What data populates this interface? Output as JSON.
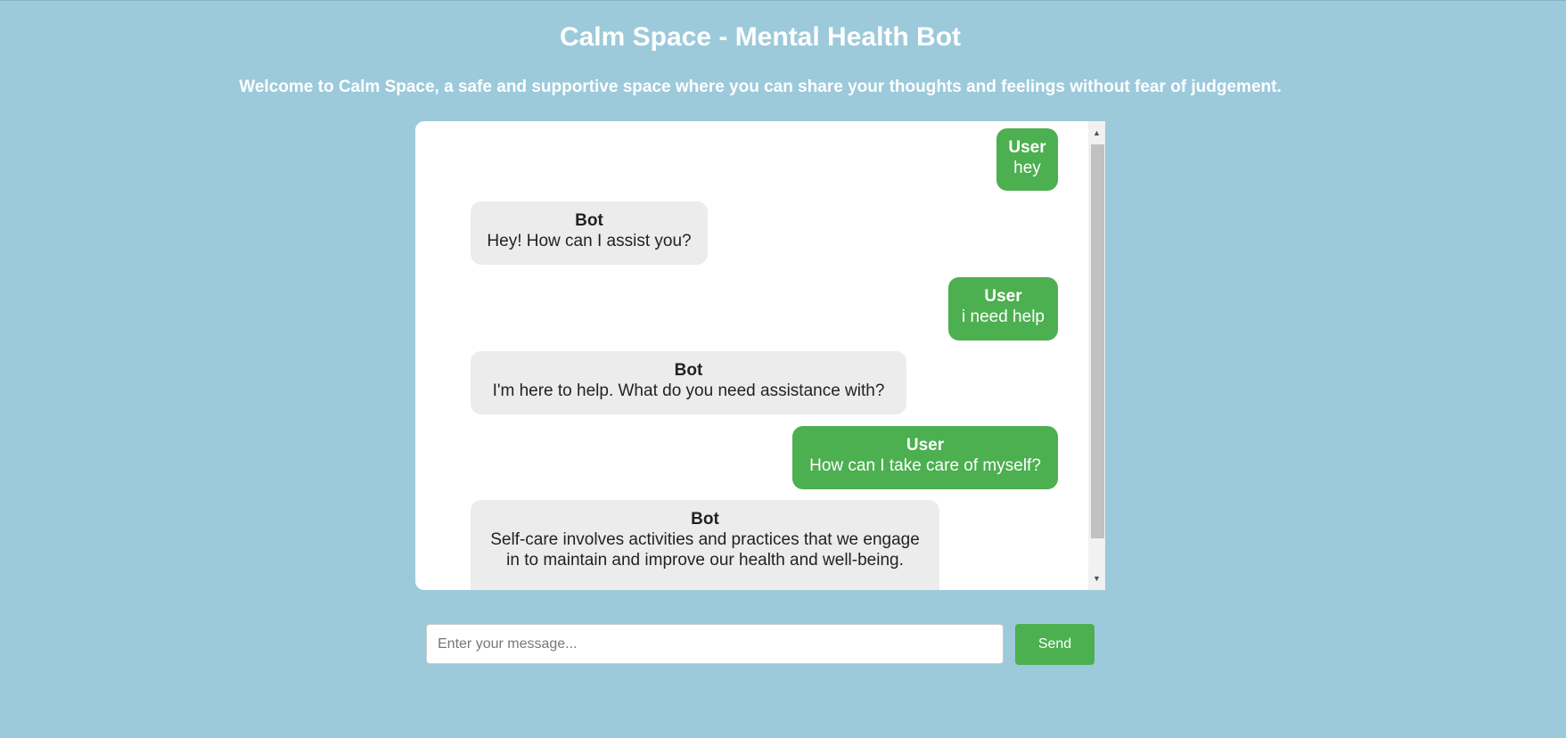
{
  "header": {
    "title": "Calm Space - Mental Health Bot",
    "subtitle": "Welcome to Calm Space, a safe and supportive space where you can share your thoughts and feelings without fear of judgement."
  },
  "chat": {
    "messages": [
      {
        "role": "user",
        "sender": "User",
        "text": "hey"
      },
      {
        "role": "bot",
        "sender": "Bot",
        "text": "Hey! How can I assist you?"
      },
      {
        "role": "user",
        "sender": "User",
        "text": "i need help"
      },
      {
        "role": "bot",
        "sender": "Bot",
        "text": "I'm here to help. What do you need assistance with?"
      },
      {
        "role": "user",
        "sender": "User",
        "text": "How can I take care of myself?"
      },
      {
        "role": "bot",
        "sender": "Bot",
        "text": "Self-care involves activities and practices that we engage in to maintain and improve our health and well-being."
      }
    ]
  },
  "scrollbar": {
    "up_icon": "scroll-up-arrow-icon",
    "down_icon": "scroll-down-arrow-icon"
  },
  "composer": {
    "placeholder": "Enter your message...",
    "value": "",
    "send_label": "Send"
  },
  "colors": {
    "background": "#9ccadb",
    "user_bubble": "#4caf50",
    "bot_bubble": "#ececec",
    "send_button": "#4caf50"
  }
}
